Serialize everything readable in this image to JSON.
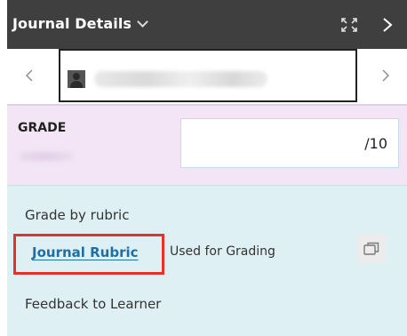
{
  "header": {
    "title": "Journal Details",
    "dropdown_icon": "chevron-down-icon",
    "expand_icon": "expand-icon",
    "next_icon": "chevron-right-icon"
  },
  "student_nav": {
    "prev_icon": "chevron-left-icon",
    "next_icon": "chevron-right-icon",
    "avatar_icon": "user-avatar-icon"
  },
  "grade": {
    "label": "GRADE",
    "value": "",
    "max": "/10"
  },
  "rubric": {
    "heading": "Grade by rubric",
    "link_text": "Journal Rubric",
    "status": "Used for Grading",
    "view_icon": "open-rubric-icon"
  },
  "feedback": {
    "label": "Feedback to Learner"
  },
  "colors": {
    "header_bg": "#3f3f3f",
    "grade_bg": "#f3e5f5",
    "rubric_bg": "#dff0f4",
    "link": "#1d6fa5",
    "highlight": "#e4322b"
  }
}
